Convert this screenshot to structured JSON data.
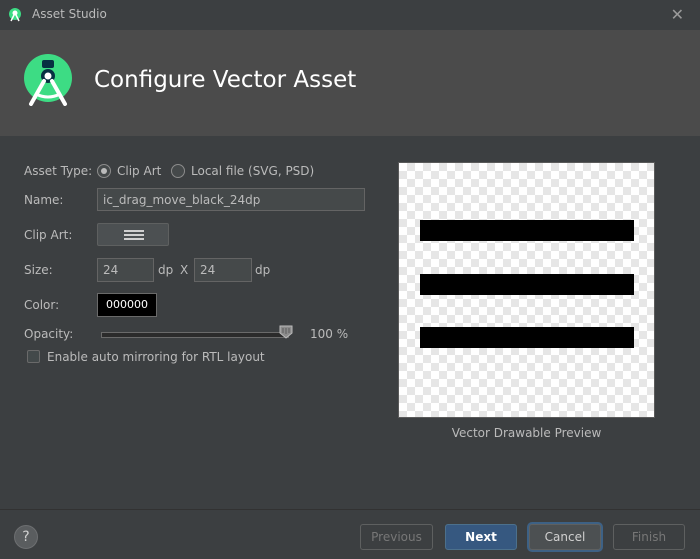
{
  "window": {
    "title": "Asset Studio"
  },
  "header": {
    "title": "Configure Vector Asset"
  },
  "form": {
    "asset_type_label": "Asset Type:",
    "asset_type_options": [
      "Clip Art",
      "Local file (SVG, PSD)"
    ],
    "asset_type_selected": "Clip Art",
    "name_label": "Name:",
    "name_value": "ic_drag_move_black_24dp",
    "clip_art_label": "Clip Art:",
    "size_label": "Size:",
    "size_width": "24",
    "size_height": "24",
    "dp_unit": "dp",
    "size_separator": "X",
    "color_label": "Color:",
    "color_value": "000000",
    "opacity_label": "Opacity:",
    "opacity_value": "100 %",
    "opacity_level": 1.0,
    "rtl_checkbox_label": "Enable auto mirroring for RTL layout",
    "rtl_checked": false
  },
  "preview": {
    "caption": "Vector Drawable Preview",
    "icon": "drag-move-icon"
  },
  "footer": {
    "help": "?",
    "previous": "Previous",
    "next": "Next",
    "cancel": "Cancel",
    "finish": "Finish"
  },
  "colors": {
    "accent": "#3ddc84",
    "primary_button": "#365880",
    "background": "#3c3f41",
    "header": "#4b4b4b"
  }
}
